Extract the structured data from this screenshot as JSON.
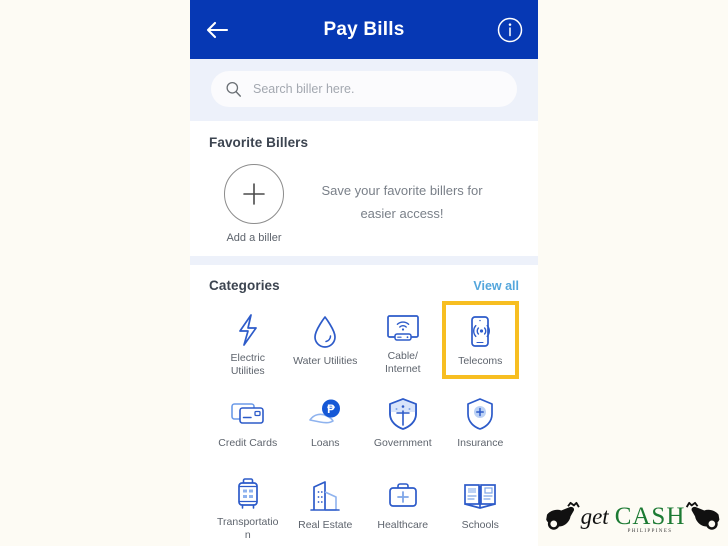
{
  "page": {
    "background_color": "#FDFBF4",
    "accent_blue": "#0638B4",
    "highlight_yellow": "#F7BE21",
    "link_blue": "#54A6DC"
  },
  "app_bar": {
    "title": "Pay Bills",
    "back_icon": "arrow-left-icon",
    "info_icon": "info-circle-icon"
  },
  "search": {
    "placeholder": "Search biller here.",
    "value": "",
    "icon": "search-icon"
  },
  "favorites": {
    "title": "Favorite Billers",
    "add_biller_label": "Add a biller",
    "add_icon": "plus-icon",
    "message_line1": "Save your favorite billers for",
    "message_line2": "easier access!"
  },
  "categories": {
    "title": "Categories",
    "view_all_label": "View all",
    "items": [
      {
        "label": "Electric Utilities",
        "icon": "lightning-bolt-icon",
        "highlighted": false
      },
      {
        "label": "Water Utilities",
        "icon": "water-drop-icon",
        "highlighted": false
      },
      {
        "label": "Cable/ Internet",
        "icon": "tv-router-icon",
        "highlighted": false
      },
      {
        "label": "Telecoms",
        "icon": "mobile-signal-icon",
        "highlighted": true
      },
      {
        "label": "Credit Cards",
        "icon": "credit-cards-icon",
        "highlighted": false
      },
      {
        "label": "Loans",
        "icon": "hand-peso-coin-icon",
        "highlighted": false
      },
      {
        "label": "Government",
        "icon": "government-shield-icon",
        "highlighted": false
      },
      {
        "label": "Insurance",
        "icon": "insurance-shield-icon",
        "highlighted": false
      },
      {
        "label": "Transportation",
        "icon": "suitcase-icon",
        "highlighted": false
      },
      {
        "label": "Real Estate",
        "icon": "buildings-icon",
        "highlighted": false
      },
      {
        "label": "Healthcare",
        "icon": "medical-kit-icon",
        "highlighted": false
      },
      {
        "label": "Schools",
        "icon": "open-book-icon",
        "highlighted": false
      }
    ]
  },
  "watermark": {
    "get_text": "get",
    "cash_text": "CASH",
    "sub_text": "PHILIPPINES"
  }
}
